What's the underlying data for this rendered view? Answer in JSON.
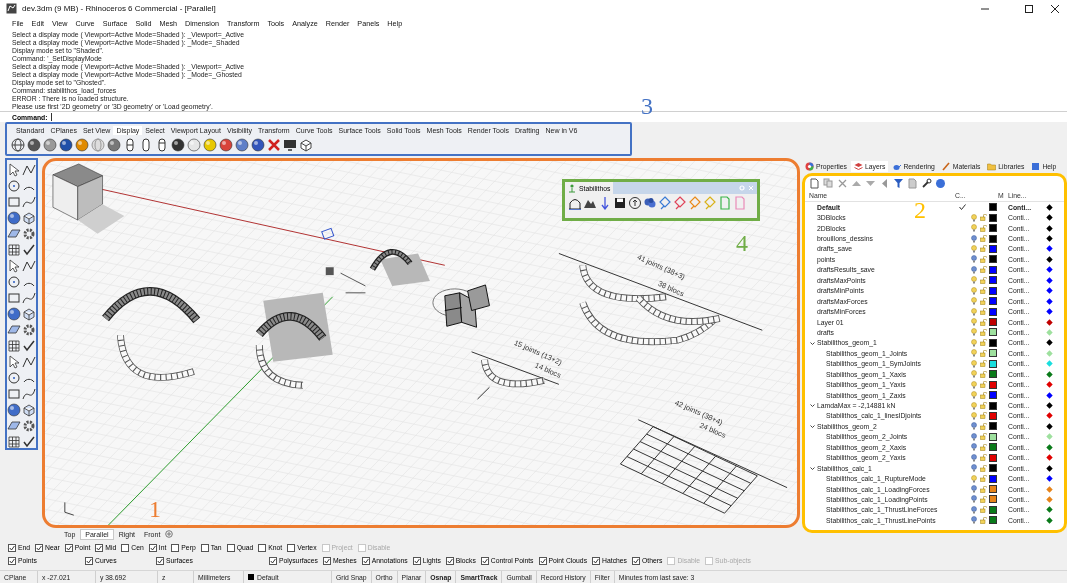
{
  "window": {
    "title": "dev.3dm (9 MB) - Rhinoceros 6 Commercial - [Parallel]"
  },
  "menu": [
    "File",
    "Edit",
    "View",
    "Curve",
    "Surface",
    "Solid",
    "Mesh",
    "Dimension",
    "Transform",
    "Tools",
    "Analyze",
    "Render",
    "Panels",
    "Help"
  ],
  "command_history": [
    "Select a display mode ( Viewport=Active  Mode=Shaded ): _Viewport=_Active",
    "Select a display mode ( Viewport=Active  Mode=Shaded ): _Mode=_Shaded",
    "Display mode set to \"Shaded\".",
    "Command: '_SetDisplayMode",
    "Select a display mode ( Viewport=Active  Mode=Shaded ): _Viewport=_Active",
    "Select a display mode ( Viewport=Active  Mode=Shaded ): _Mode=_Ghosted",
    "Display mode set to \"Ghosted\".",
    "Command: stabilithos_load_forces",
    "ERROR : There is no loaded structure.",
    "Please use first '2D geometry' or '3D geometry' or 'Load geometry'."
  ],
  "command_prompt": "Command:",
  "toolbar": {
    "callout": {
      "label": "3",
      "color": "#4472c4"
    },
    "tabs": [
      {
        "label": "Standard",
        "selected": false
      },
      {
        "label": "CPlanes",
        "selected": false
      },
      {
        "label": "Set View",
        "selected": false
      },
      {
        "label": "Display",
        "selected": true
      },
      {
        "label": "Select",
        "selected": false
      },
      {
        "label": "Viewport Layout",
        "selected": false
      },
      {
        "label": "Visibility",
        "selected": false
      },
      {
        "label": "Transform",
        "selected": false
      },
      {
        "label": "Curve Tools",
        "selected": false
      },
      {
        "label": "Surface Tools",
        "selected": false
      },
      {
        "label": "Solid Tools",
        "selected": false
      },
      {
        "label": "Mesh Tools",
        "selected": false
      },
      {
        "label": "Render Tools",
        "selected": false
      },
      {
        "label": "Drafting",
        "selected": false
      },
      {
        "label": "New in V6",
        "selected": false
      }
    ]
  },
  "viewport": {
    "callout": {
      "label": "1",
      "color": "#ed7d31"
    },
    "annotations": [
      "41 joints (38+3)",
      "38 blocs",
      "15 joints (13+2)",
      "14 blocs",
      "42 joints (38+4)",
      "24 blocs"
    ],
    "plugin_toolbar": {
      "title": "Stabilithos",
      "callout": {
        "label": "4",
        "color": "#70ad47"
      }
    },
    "tabs": [
      {
        "label": "Top",
        "selected": false
      },
      {
        "label": "Parallel",
        "selected": true
      },
      {
        "label": "Right",
        "selected": false
      },
      {
        "label": "Front",
        "selected": false
      }
    ]
  },
  "panel": {
    "callout": {
      "label": "2",
      "color": "#ffc000"
    },
    "tabs": [
      {
        "label": "Properties",
        "selected": false
      },
      {
        "label": "Layers",
        "selected": true
      },
      {
        "label": "Rendering",
        "selected": false
      },
      {
        "label": "Materials",
        "selected": false
      },
      {
        "label": "Libraries",
        "selected": false
      },
      {
        "label": "Help",
        "selected": false
      }
    ],
    "columns": [
      "Name",
      "C...",
      "M",
      "Line..."
    ],
    "layers": [
      {
        "name": "Default",
        "current": true,
        "color": "#000000",
        "linetype": "Conti..."
      },
      {
        "name": "3DBlocks",
        "current": false,
        "visible": true,
        "color": "#000000",
        "linetype": "Conti..."
      },
      {
        "name": "2DBlocks",
        "current": false,
        "visible": true,
        "color": "#000000",
        "linetype": "Conti..."
      },
      {
        "name": "brouillons_dessins",
        "current": false,
        "visible": false,
        "color": "#000000",
        "linetype": "Conti..."
      },
      {
        "name": "drafts_save",
        "current": false,
        "visible": true,
        "color": "#0000ff",
        "linetype": "Conti..."
      },
      {
        "name": "points",
        "current": false,
        "visible": false,
        "color": "#000000",
        "linetype": "Conti..."
      },
      {
        "name": "draftsResults_save",
        "current": false,
        "visible": false,
        "color": "#0000ff",
        "linetype": "Conti..."
      },
      {
        "name": "draftsMaxPoints",
        "current": false,
        "visible": true,
        "color": "#0000ff",
        "linetype": "Conti..."
      },
      {
        "name": "draftsMinPoints",
        "current": false,
        "visible": true,
        "color": "#0000ff",
        "linetype": "Conti..."
      },
      {
        "name": "draftsMaxForces",
        "current": false,
        "visible": true,
        "color": "#0000ff",
        "linetype": "Conti..."
      },
      {
        "name": "draftsMinForces",
        "current": false,
        "visible": true,
        "color": "#0000ff",
        "linetype": "Conti..."
      },
      {
        "name": "Layer 01",
        "current": false,
        "visible": true,
        "color": "#c00000",
        "linetype": "Conti..."
      },
      {
        "name": "drafts",
        "current": false,
        "visible": true,
        "color": "#9ee09e",
        "linetype": "Conti..."
      },
      {
        "name": "Stabilithos_geom_1",
        "current": false,
        "visible": true,
        "color": "#000000",
        "linetype": "Conti...",
        "expanded": true,
        "children": [
          {
            "name": "Stabilithos_geom_1_Joints",
            "current": false,
            "visible": true,
            "color": "#9ee09e",
            "linetype": "Conti..."
          },
          {
            "name": "Stabilithos_geom_1_SymJoints",
            "current": false,
            "visible": true,
            "color": "#19dede",
            "linetype": "Conti..."
          },
          {
            "name": "Stabilithos_geom_1_Xaxis",
            "current": false,
            "visible": true,
            "color": "#0a7a1a",
            "linetype": "Conti..."
          },
          {
            "name": "Stabilithos_geom_1_Yaxis",
            "current": false,
            "visible": true,
            "color": "#e00000",
            "linetype": "Conti..."
          },
          {
            "name": "Stabilithos_geom_1_Zaxis",
            "current": false,
            "visible": true,
            "color": "#0000ff",
            "linetype": "Conti..."
          }
        ]
      },
      {
        "name": "LamdaMax = -2,14881 kN",
        "current": false,
        "visible": true,
        "color": "#000000",
        "linetype": "Conti...",
        "expanded": true,
        "children": [
          {
            "name": "Stabilithos_calc_1_linesIDjoints",
            "current": false,
            "visible": true,
            "color": "#e00000",
            "linetype": "Conti..."
          }
        ]
      },
      {
        "name": "Stabilithos_geom_2",
        "current": false,
        "visible": false,
        "color": "#000000",
        "linetype": "Conti...",
        "expanded": true,
        "children": [
          {
            "name": "Stabilithos_geom_2_Joints",
            "current": false,
            "visible": false,
            "color": "#9ee09e",
            "linetype": "Conti..."
          },
          {
            "name": "Stabilithos_geom_2_Xaxis",
            "current": false,
            "visible": false,
            "color": "#0a7a1a",
            "linetype": "Conti..."
          },
          {
            "name": "Stabilithos_geom_2_Yaxis",
            "current": false,
            "visible": false,
            "color": "#e00000",
            "linetype": "Conti..."
          }
        ]
      },
      {
        "name": "Stabilithos_calc_1",
        "current": false,
        "visible": false,
        "color": "#000000",
        "linetype": "Conti...",
        "expanded": true,
        "children": [
          {
            "name": "Stabilithos_calc_1_RuptureMode",
            "current": false,
            "visible": true,
            "color": "#0000ff",
            "linetype": "Conti..."
          },
          {
            "name": "Stabilithos_calc_1_LoadingForces",
            "current": false,
            "visible": false,
            "color": "#e6841a",
            "linetype": "Conti..."
          },
          {
            "name": "Stabilithos_calc_1_LoadingPoints",
            "current": false,
            "visible": false,
            "color": "#e6841a",
            "linetype": "Conti..."
          },
          {
            "name": "Stabilithos_calc_1_ThrustLineForces",
            "current": false,
            "visible": false,
            "color": "#0a7a1a",
            "linetype": "Conti..."
          },
          {
            "name": "Stabilithos_calc_1_ThrustLinePoints",
            "current": false,
            "visible": false,
            "color": "#0a7a1a",
            "linetype": "Conti..."
          }
        ]
      }
    ]
  },
  "osnaps": [
    {
      "label": "End",
      "checked": true,
      "disabled": false
    },
    {
      "label": "Near",
      "checked": true,
      "disabled": false
    },
    {
      "label": "Point",
      "checked": true,
      "disabled": false
    },
    {
      "label": "Mid",
      "checked": true,
      "disabled": false
    },
    {
      "label": "Cen",
      "checked": false,
      "disabled": false
    },
    {
      "label": "Int",
      "checked": true,
      "disabled": false
    },
    {
      "label": "Perp",
      "checked": false,
      "disabled": false
    },
    {
      "label": "Tan",
      "checked": false,
      "disabled": false
    },
    {
      "label": "Quad",
      "checked": false,
      "disabled": false
    },
    {
      "label": "Knot",
      "checked": false,
      "disabled": false
    },
    {
      "label": "Vertex",
      "checked": false,
      "disabled": false
    },
    {
      "label": "Project",
      "checked": false,
      "disabled": true
    },
    {
      "label": "Disable",
      "checked": false,
      "disabled": true
    }
  ],
  "filters": [
    {
      "label": "Points",
      "checked": true,
      "disabled": false
    },
    {
      "label": "Curves",
      "checked": true,
      "disabled": false
    },
    {
      "label": "Surfaces",
      "checked": true,
      "disabled": false
    },
    {
      "label": "Polysurfaces",
      "checked": true,
      "disabled": false
    },
    {
      "label": "Meshes",
      "checked": true,
      "disabled": false
    },
    {
      "label": "Annotations",
      "checked": true,
      "disabled": false
    },
    {
      "label": "Lights",
      "checked": true,
      "disabled": false
    },
    {
      "label": "Blocks",
      "checked": true,
      "disabled": false
    },
    {
      "label": "Control Points",
      "checked": true,
      "disabled": false
    },
    {
      "label": "Point Clouds",
      "checked": true,
      "disabled": false
    },
    {
      "label": "Hatches",
      "checked": true,
      "disabled": false
    },
    {
      "label": "Others",
      "checked": true,
      "disabled": false
    },
    {
      "label": "Disable",
      "checked": false,
      "disabled": true
    },
    {
      "label": "Sub-objects",
      "checked": false,
      "disabled": true
    }
  ],
  "status_bar": {
    "cplane": "CPlane",
    "x": "x -27.021",
    "y": "y 38.692",
    "z": "z",
    "units": "Millimeters",
    "layer": {
      "name": "Default",
      "color": "#000000"
    },
    "toggles": [
      {
        "label": "Grid Snap",
        "on": false
      },
      {
        "label": "Ortho",
        "on": false
      },
      {
        "label": "Planar",
        "on": false
      },
      {
        "label": "Osnap",
        "on": true
      },
      {
        "label": "SmartTrack",
        "on": true
      },
      {
        "label": "Gumball",
        "on": false
      },
      {
        "label": "Record History",
        "on": false
      },
      {
        "label": "Filter",
        "on": false
      }
    ],
    "message": "Minutes from last save: 3"
  }
}
